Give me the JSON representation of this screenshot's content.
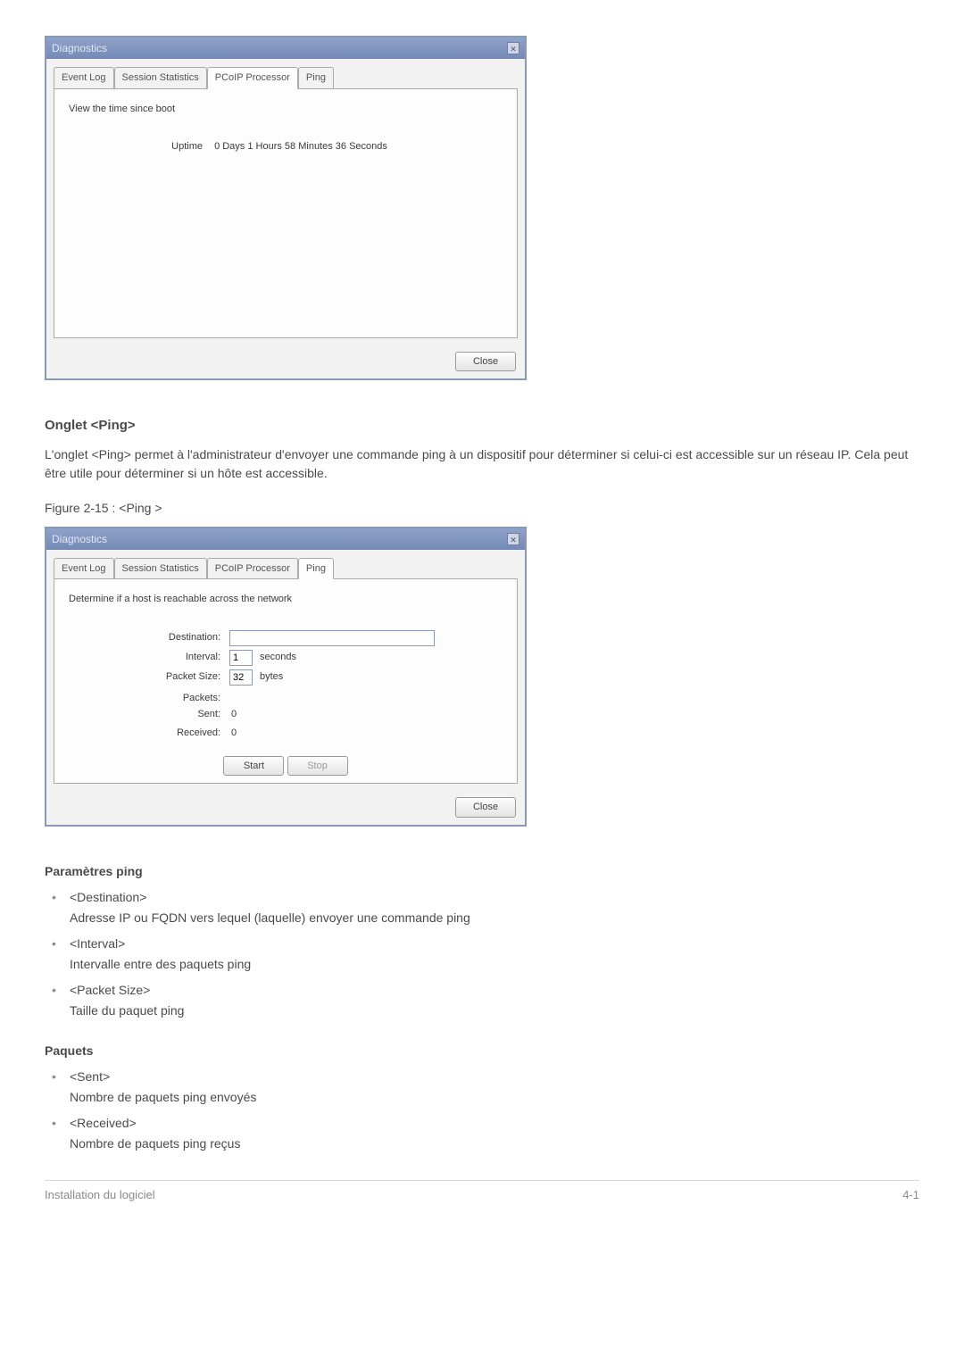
{
  "dialog1": {
    "title": "Diagnostics",
    "close_glyph": "✕",
    "tabs": [
      "Event Log",
      "Session Statistics",
      "PCoIP Processor",
      "Ping"
    ],
    "active_tab_index": 2,
    "desc": "View the time since boot",
    "uptime_label": "Uptime",
    "uptime_value": "0 Days 1 Hours 58 Minutes 36 Seconds",
    "close_btn": "Close"
  },
  "section_ping": {
    "heading": "Onglet <Ping>",
    "para": "L'onglet <Ping> permet à l'administrateur d'envoyer une commande ping à un dispositif pour déterminer si celui-ci est accessible sur un réseau IP. Cela peut être utile pour déterminer si un hôte est accessible.",
    "figure_caption": "Figure 2-15 : <Ping >"
  },
  "dialog2": {
    "title": "Diagnostics",
    "close_glyph": "✕",
    "tabs": [
      "Event Log",
      "Session Statistics",
      "PCoIP Processor",
      "Ping"
    ],
    "active_tab_index": 3,
    "desc": "Determine if a host is reachable across the network",
    "labels": {
      "destination": "Destination:",
      "interval": "Interval:",
      "packet_size": "Packet Size:",
      "packets": "Packets:",
      "sent": "Sent:",
      "received": "Received:"
    },
    "values": {
      "destination": "",
      "interval": "1",
      "interval_unit": "seconds",
      "packet_size": "32",
      "packet_size_unit": "bytes",
      "sent": "0",
      "received": "0"
    },
    "start_btn": "Start",
    "stop_btn": "Stop",
    "close_btn": "Close"
  },
  "params_section": {
    "heading": "Paramètres ping",
    "items": [
      {
        "name": "<Destination>",
        "desc": "Adresse IP ou FQDN vers lequel (laquelle) envoyer une commande ping"
      },
      {
        "name": "<Interval>",
        "desc": "Intervalle entre des paquets ping"
      },
      {
        "name": "<Packet Size>",
        "desc": "Taille du paquet ping"
      }
    ]
  },
  "packets_section": {
    "heading": "Paquets",
    "items": [
      {
        "name": "<Sent>",
        "desc": "Nombre de paquets ping envoyés"
      },
      {
        "name": "<Received>",
        "desc": "Nombre de paquets ping reçus"
      }
    ]
  },
  "footer": {
    "left": "Installation du logiciel",
    "right": "4-1"
  }
}
